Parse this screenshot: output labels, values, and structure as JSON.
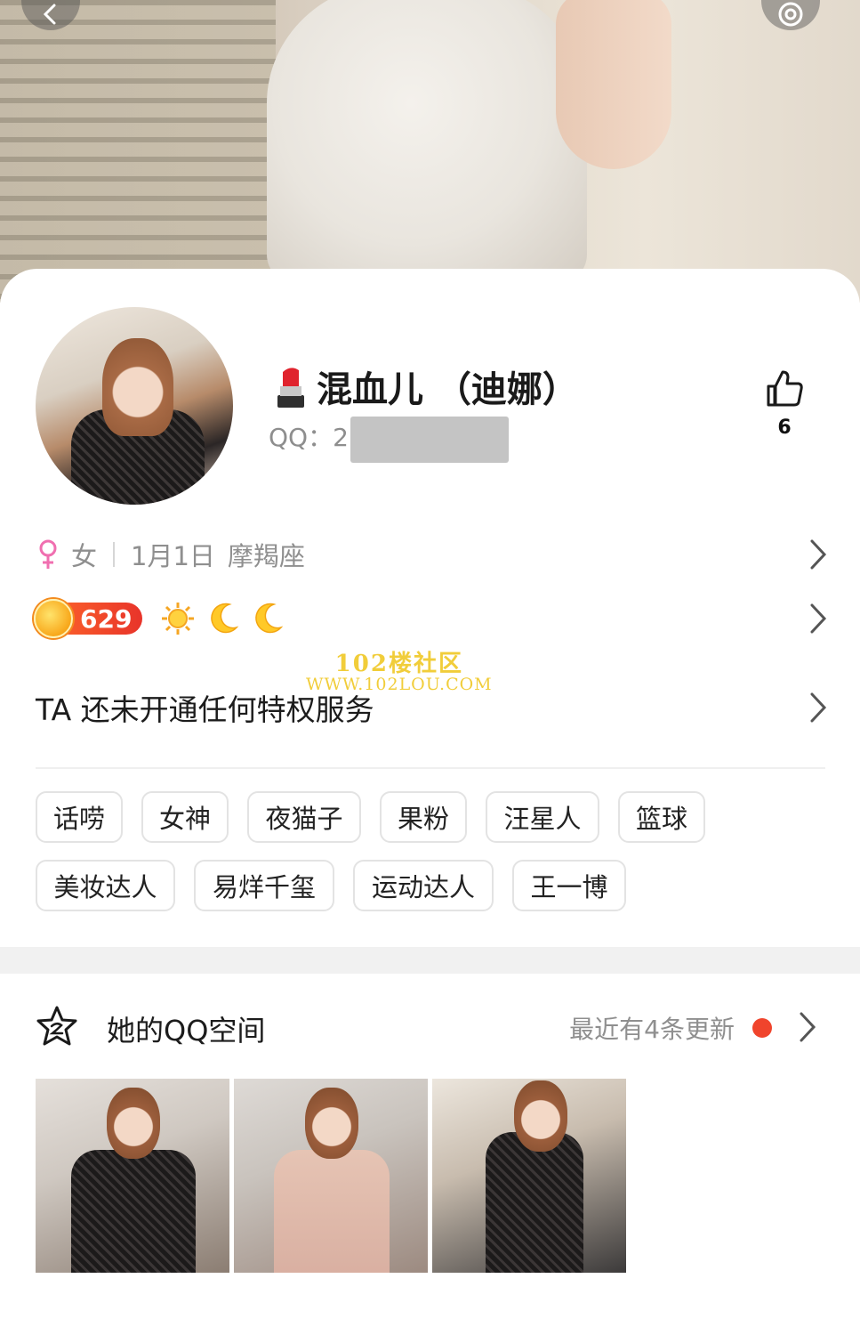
{
  "profile": {
    "name": "混血儿 （迪娜）",
    "qq_label": "QQ：",
    "qq_visible": "2",
    "likes": "6"
  },
  "info": {
    "gender": "女",
    "birthday": "1月1日",
    "zodiac": "摩羯座"
  },
  "level": {
    "value": "629"
  },
  "watermark": {
    "line1": "102楼社区",
    "line2": "WWW.102LOU.COM"
  },
  "privilege": {
    "text": "TA 还未开通任何特权服务"
  },
  "tags": [
    "话唠",
    "女神",
    "夜猫子",
    "果粉",
    "汪星人",
    "篮球",
    "美妆达人",
    "易烊千玺",
    "运动达人",
    "王一博"
  ],
  "qzone": {
    "title": "她的QQ空间",
    "updates": "最近有4条更新"
  },
  "colors": {
    "accent_red": "#f0442c",
    "level_badge": "#e8342a",
    "female_pink": "#f06fb0"
  }
}
